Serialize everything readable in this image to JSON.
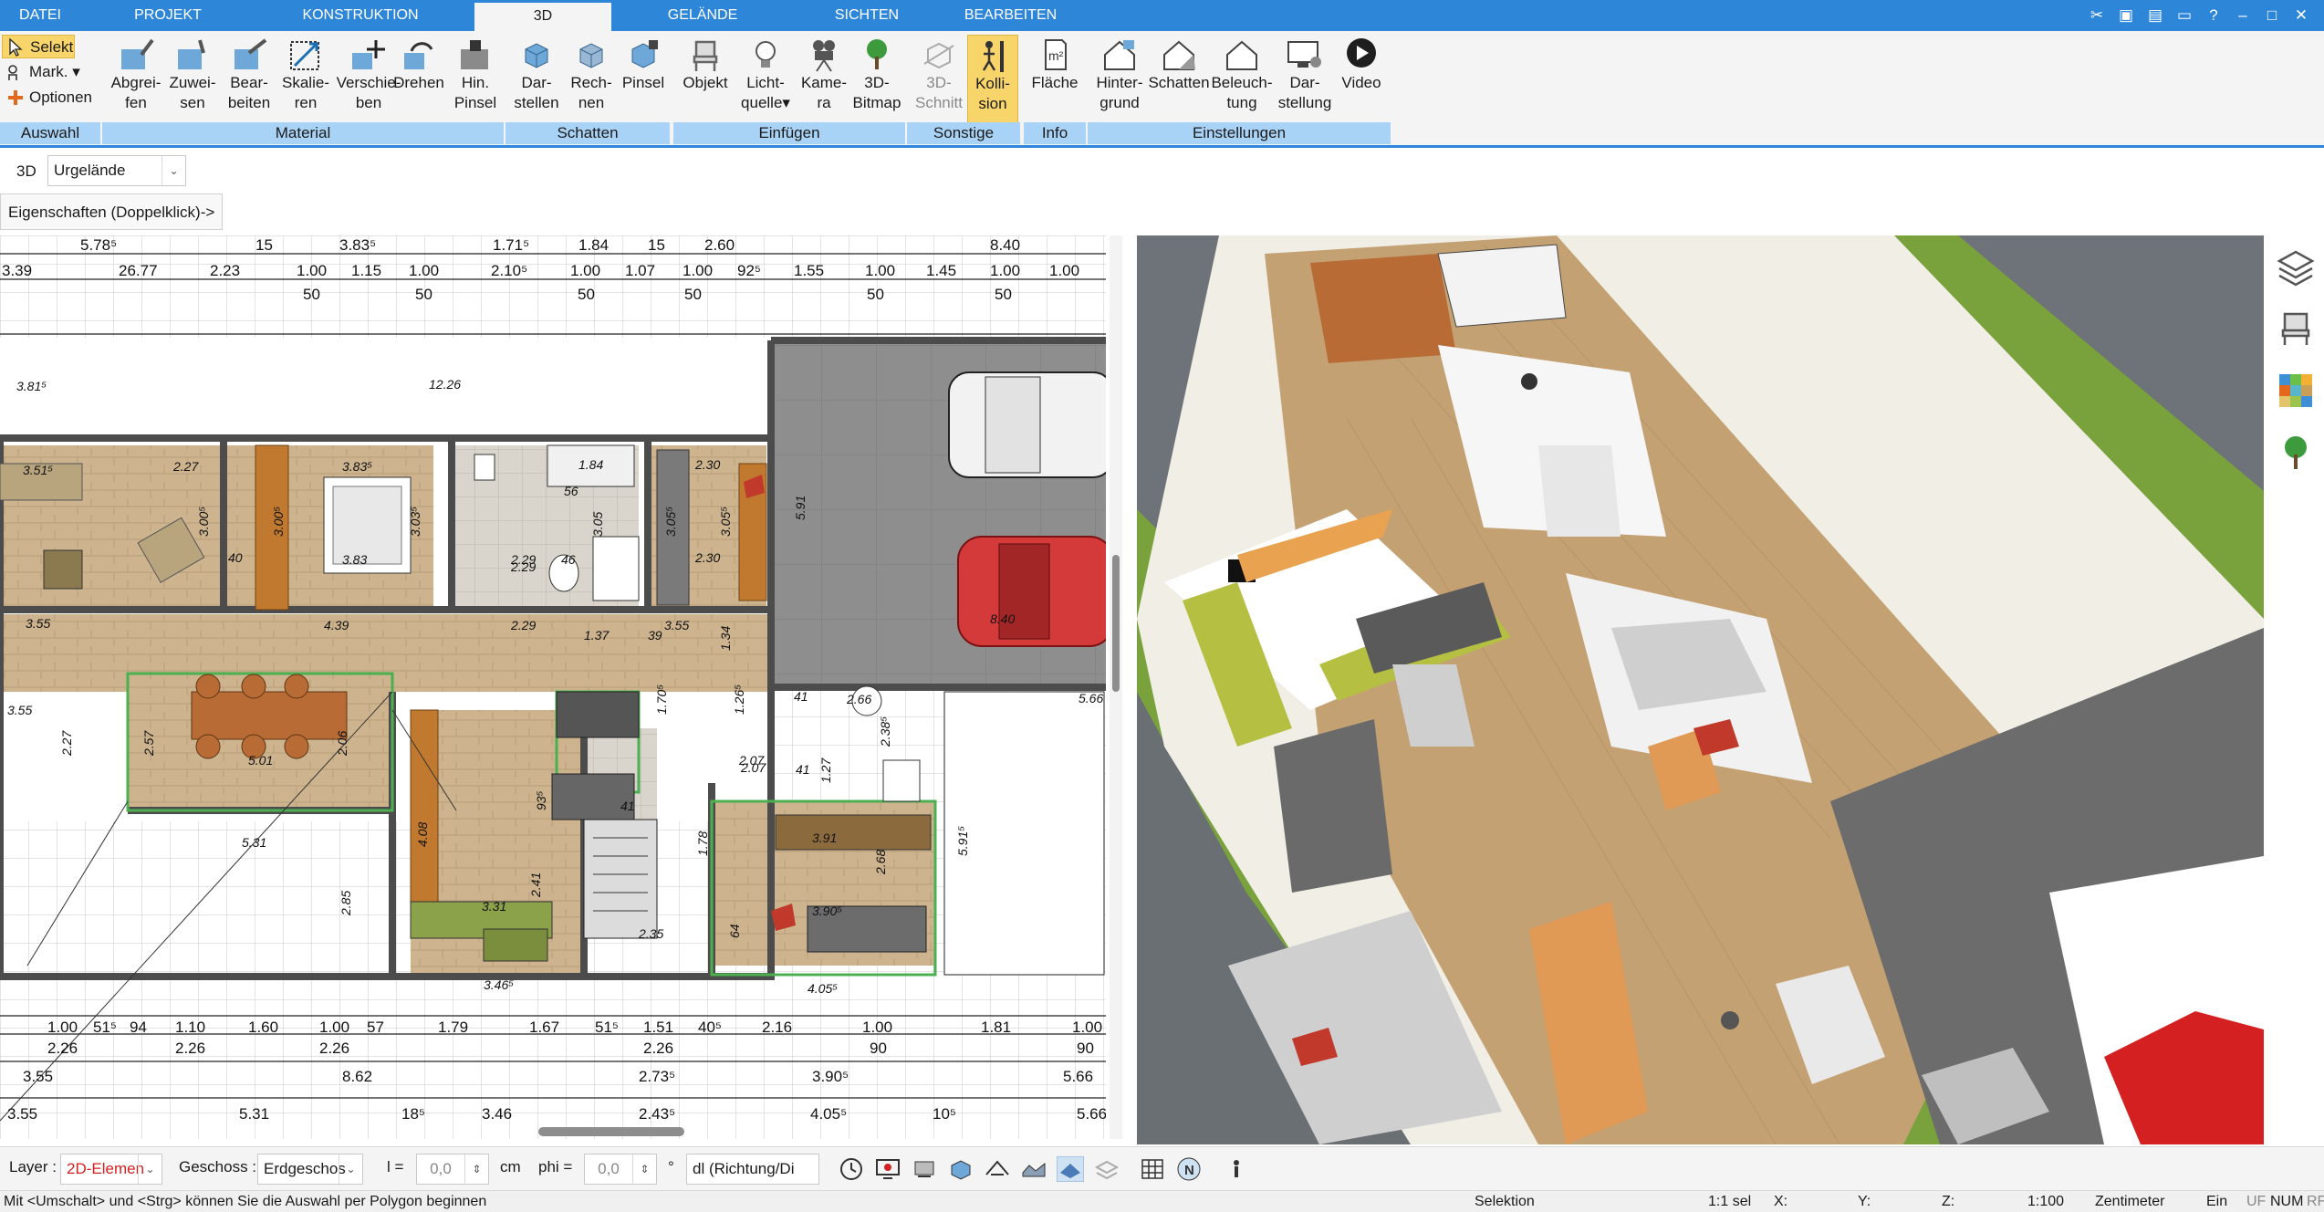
{
  "menu": {
    "tabs": [
      {
        "label": "DATEI"
      },
      {
        "label": "PROJEKT"
      },
      {
        "label": "KONSTRUKTION"
      },
      {
        "label": "3D"
      },
      {
        "label": "GELÄNDE"
      },
      {
        "label": "SICHTEN"
      },
      {
        "label": "BEARBEITEN"
      }
    ],
    "active_tab": "3D"
  },
  "ribbon": {
    "selection": {
      "select": "Selekt",
      "mark": "Mark.",
      "options": "Optionen",
      "group": "Auswahl"
    },
    "material": {
      "items": [
        {
          "line1": "Abgrei-",
          "line2": "fen"
        },
        {
          "line1": "Zuwei-",
          "line2": "sen"
        },
        {
          "line1": "Bear-",
          "line2": "beiten"
        },
        {
          "line1": "Skalie-",
          "line2": "ren"
        },
        {
          "line1": "Verschie-",
          "line2": "ben"
        },
        {
          "line1": "Drehen",
          "line2": ""
        },
        {
          "line1": "Hin.",
          "line2": "Pinsel"
        }
      ],
      "group": "Material"
    },
    "schatten": {
      "items": [
        {
          "line1": "Dar-",
          "line2": "stellen"
        },
        {
          "line1": "Rech-",
          "line2": "nen"
        },
        {
          "line1": "Pinsel",
          "line2": ""
        }
      ],
      "group": "Schatten"
    },
    "einfuegen": {
      "items": [
        {
          "line1": "Objekt",
          "line2": ""
        },
        {
          "line1": "Licht-",
          "line2": "quelle"
        },
        {
          "line1": "Kame-",
          "line2": "ra"
        },
        {
          "line1": "3D-",
          "line2": "Bitmap"
        }
      ],
      "group": "Einfügen"
    },
    "sonstige": {
      "items": [
        {
          "line1": "3D-",
          "line2": "Schnitt"
        },
        {
          "line1": "Kolli-",
          "line2": "sion"
        }
      ],
      "group": "Sonstige"
    },
    "info": {
      "items": [
        {
          "line1": "Fläche",
          "line2": ""
        }
      ],
      "group": "Info"
    },
    "einstellungen": {
      "items": [
        {
          "line1": "Hinter-",
          "line2": "grund"
        },
        {
          "line1": "Schatten",
          "line2": ""
        },
        {
          "line1": "Beleuch-",
          "line2": "tung"
        },
        {
          "line1": "Dar-",
          "line2": "stellung"
        },
        {
          "line1": "Video",
          "line2": ""
        }
      ],
      "group": "Einstellungen"
    }
  },
  "optionbar": {
    "view_label": "3D",
    "terrain_value": "Urgelände",
    "properties_button": "Eigenschaften (Doppelklick)->"
  },
  "plan": {
    "top_dims_row1": [
      "5.78⁵",
      "15",
      "3.83⁵",
      "1.71⁵",
      "1.84",
      "15",
      "2.60",
      "8.40"
    ],
    "top_dims_row2": [
      "3.39",
      "26.77",
      "2.23",
      "1.00",
      "1.15",
      "1.00",
      "2.10⁵",
      "1.00",
      "1.07",
      "1.00",
      "92⁵",
      "1.55",
      "1.00",
      "1.45",
      "1.00",
      "1.00"
    ],
    "top_dims_row3": [
      "50",
      "50",
      "50",
      "50",
      "50",
      "50"
    ],
    "room_labels": [
      "3.81⁵",
      "12.26",
      "2.27",
      "3.83⁵",
      "56",
      "1.84",
      "2.30",
      "5.91",
      "3.51⁵",
      "3.00⁵",
      "3.00⁵",
      "3.03⁵",
      "2.29",
      "3.05",
      "3.05⁵",
      "3.05⁵",
      "40",
      "3.83",
      "2.29",
      "46",
      "2.30",
      "8.40",
      "3.55",
      "4.39",
      "2.29",
      "1.37",
      "39",
      "3.55",
      "1.34",
      "3.55",
      "5.01",
      "2.27",
      "2.57",
      "2.06",
      "2.07",
      "1.70⁵",
      "1.26⁵",
      "41",
      "2.66",
      "5.66",
      "2.38⁵",
      "2.07",
      "1.27",
      "41",
      "5.31",
      "4.08",
      "93⁵",
      "41",
      "1.78",
      "3.91",
      "5.91⁵",
      "2.85",
      "3.31",
      "2.41",
      "2.68",
      "3.90⁵",
      "64",
      "2.35",
      "4.05⁵",
      "3.46⁵"
    ],
    "bottom_dims_row1": [
      "1.00",
      "51⁵",
      "94",
      "1.10",
      "1.60",
      "1.00",
      "57",
      "1.79",
      "1.67",
      "51⁵",
      "1.51",
      "40⁵",
      "2.16",
      "1.00",
      "1.81",
      "1.00"
    ],
    "bottom_dims_row2": [
      "2.26",
      "2.26",
      "2.26",
      "2.26",
      "90",
      "90"
    ],
    "bottom_dims_row3": [
      "3.55",
      "8.62",
      "2.73⁵",
      "3.90⁵",
      "5.66"
    ],
    "bottom_dims_row4": [
      "3.55",
      "5.31",
      "18⁵",
      "3.46",
      "2.43⁵",
      "4.05⁵",
      "10⁵",
      "5.66"
    ]
  },
  "bottombar": {
    "layer_label": "Layer :",
    "layer_value": "2D-Elemen",
    "floor_label": "Geschoss :",
    "floor_value": "Erdgeschos",
    "l_label": "l =",
    "l_value": "0,0",
    "l_unit": "cm",
    "phi_label": "phi =",
    "phi_value": "0,0",
    "phi_unit": "°",
    "direction_value": "dl (Richtung/Di"
  },
  "statusbar": {
    "hint": "Mit <Umschalt> und <Strg> können Sie die Auswahl per Polygon beginnen",
    "mode": "Selektion",
    "sel": "1:1 sel",
    "x": "X:",
    "y": "Y:",
    "z": "Z:",
    "scale": "1:100",
    "unit": "Zentimeter",
    "ein": "Ein",
    "uf": "UF",
    "num": "NUM",
    "rf": "RF"
  },
  "colors": {
    "accent": "#2e86d8",
    "ribbon_group": "#a9d3f6",
    "active_button": "#f8d56a",
    "layer_value": "#d42020"
  }
}
